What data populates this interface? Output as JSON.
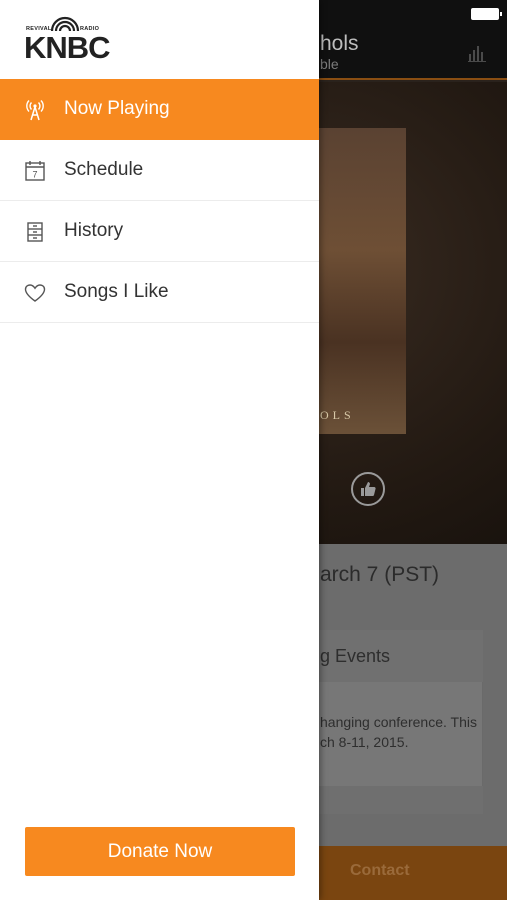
{
  "background": {
    "header_title": "hols",
    "header_subtitle": "ble",
    "album_text": "OLS",
    "date_text": "arch 7 (PST)",
    "card_title": "g Events",
    "card_body_line1": "hanging conference. This",
    "card_body_line2": "ch 8-11, 2015.",
    "contact_label": "Contact"
  },
  "logo": {
    "text": "KNBC",
    "top_left": "REVIVAL",
    "top_right": "RADIO"
  },
  "nav": {
    "items": [
      {
        "label": "Now Playing",
        "icon": "radio-tower-icon",
        "active": true
      },
      {
        "label": "Schedule",
        "icon": "calendar-icon",
        "calendar_day": "7"
      },
      {
        "label": "History",
        "icon": "cabinet-icon"
      },
      {
        "label": "Songs I Like",
        "icon": "heart-icon"
      }
    ]
  },
  "donate": {
    "label": "Donate Now"
  },
  "colors": {
    "accent": "#f7891f",
    "drawer_bg": "#ffffff",
    "text": "#333333"
  }
}
